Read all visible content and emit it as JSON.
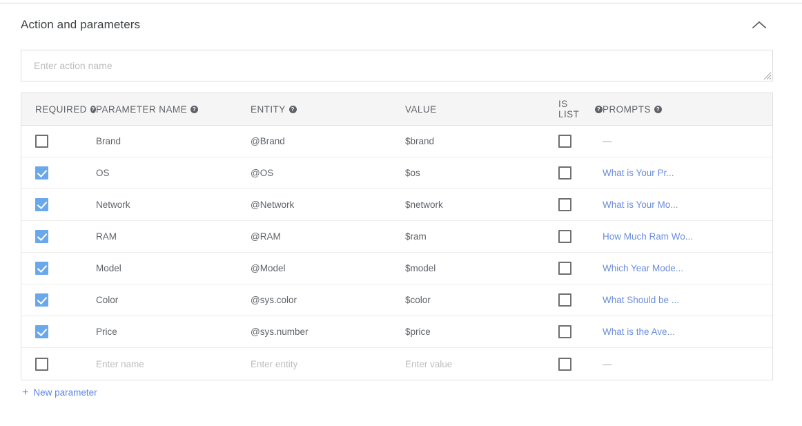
{
  "section": {
    "title": "Action and parameters",
    "collapse_icon": "chevron-up-icon"
  },
  "action_input": {
    "value": "",
    "placeholder": "Enter action name"
  },
  "table": {
    "columns": [
      {
        "label": "REQUIRED",
        "has_help": true
      },
      {
        "label": "PARAMETER NAME",
        "has_help": true
      },
      {
        "label": "ENTITY",
        "has_help": true
      },
      {
        "label": "VALUE",
        "has_help": false
      },
      {
        "label": "IS LIST",
        "has_help": true
      },
      {
        "label": "PROMPTS",
        "has_help": true
      }
    ],
    "rows": [
      {
        "required": false,
        "name": "Brand",
        "entity": "@Brand",
        "value": "$brand",
        "is_list": false,
        "prompt": "—",
        "prompt_is_link": false,
        "placeholder_row": false
      },
      {
        "required": true,
        "name": "OS",
        "entity": "@OS",
        "value": "$os",
        "is_list": false,
        "prompt": "What is Your Pr...",
        "prompt_is_link": true,
        "placeholder_row": false
      },
      {
        "required": true,
        "name": "Network",
        "entity": "@Network",
        "value": "$network",
        "is_list": false,
        "prompt": "What is Your Mo...",
        "prompt_is_link": true,
        "placeholder_row": false
      },
      {
        "required": true,
        "name": "RAM",
        "entity": "@RAM",
        "value": "$ram",
        "is_list": false,
        "prompt": "How Much Ram Wo...",
        "prompt_is_link": true,
        "placeholder_row": false
      },
      {
        "required": true,
        "name": "Model",
        "entity": "@Model",
        "value": "$model",
        "is_list": false,
        "prompt": "Which Year Mode...",
        "prompt_is_link": true,
        "placeholder_row": false
      },
      {
        "required": true,
        "name": "Color",
        "entity": "@sys.color",
        "value": "$color",
        "is_list": false,
        "prompt": "What Should be ...",
        "prompt_is_link": true,
        "placeholder_row": false
      },
      {
        "required": true,
        "name": "Price",
        "entity": "@sys.number",
        "value": "$price",
        "is_list": false,
        "prompt": "What is the Ave...",
        "prompt_is_link": true,
        "placeholder_row": false
      },
      {
        "required": false,
        "name": "Enter name",
        "entity": "Enter entity",
        "value": "Enter value",
        "is_list": false,
        "prompt": "—",
        "prompt_is_link": false,
        "placeholder_row": true
      }
    ]
  },
  "footer": {
    "new_parameter_label": "New parameter",
    "new_parameter_icon": "plus-icon"
  },
  "colors": {
    "checkbox_checked": "#6aa8e9",
    "link": "#5c86e6",
    "prompt_link": "#6b8ede",
    "header_bg": "#f5f5f5",
    "border": "#e0e0e0"
  }
}
